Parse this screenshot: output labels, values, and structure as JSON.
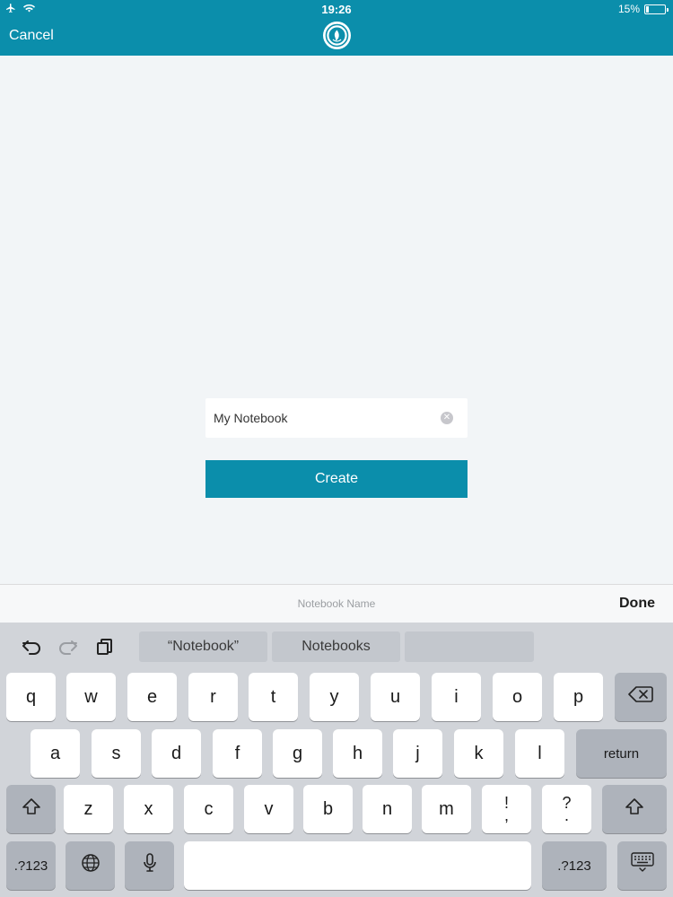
{
  "status_bar": {
    "time": "19:26",
    "battery": "15%",
    "battery_level": 0.15,
    "icons": [
      "airplane-icon",
      "wifi-icon",
      "battery-icon"
    ]
  },
  "nav": {
    "cancel_label": "Cancel",
    "logo": "app-logo-icon"
  },
  "form": {
    "notebook_name_value": "My Notebook",
    "create_label": "Create",
    "clear_icon": "clear-icon"
  },
  "accessory": {
    "title": "Notebook Name",
    "done_label": "Done"
  },
  "keyboard": {
    "toolbar_icons": [
      "undo-icon",
      "redo-icon",
      "paste-icon"
    ],
    "suggestions": [
      "“Notebook”",
      "Notebooks",
      ""
    ],
    "row1": [
      "q",
      "w",
      "e",
      "r",
      "t",
      "y",
      "u",
      "i",
      "o",
      "p"
    ],
    "row2": [
      "a",
      "s",
      "d",
      "f",
      "g",
      "h",
      "j",
      "k",
      "l"
    ],
    "row3": [
      "z",
      "x",
      "c",
      "v",
      "b",
      "n",
      "m"
    ],
    "punct1": [
      "!",
      ","
    ],
    "punct2": [
      "?",
      "."
    ],
    "return_label": "return",
    "numbers_label": ".?123",
    "colors": {
      "accent": "#0b8eab",
      "key": "#ffffff",
      "dark_key": "#aeb3bb",
      "keyboard_bg": "#d1d4d9"
    }
  }
}
